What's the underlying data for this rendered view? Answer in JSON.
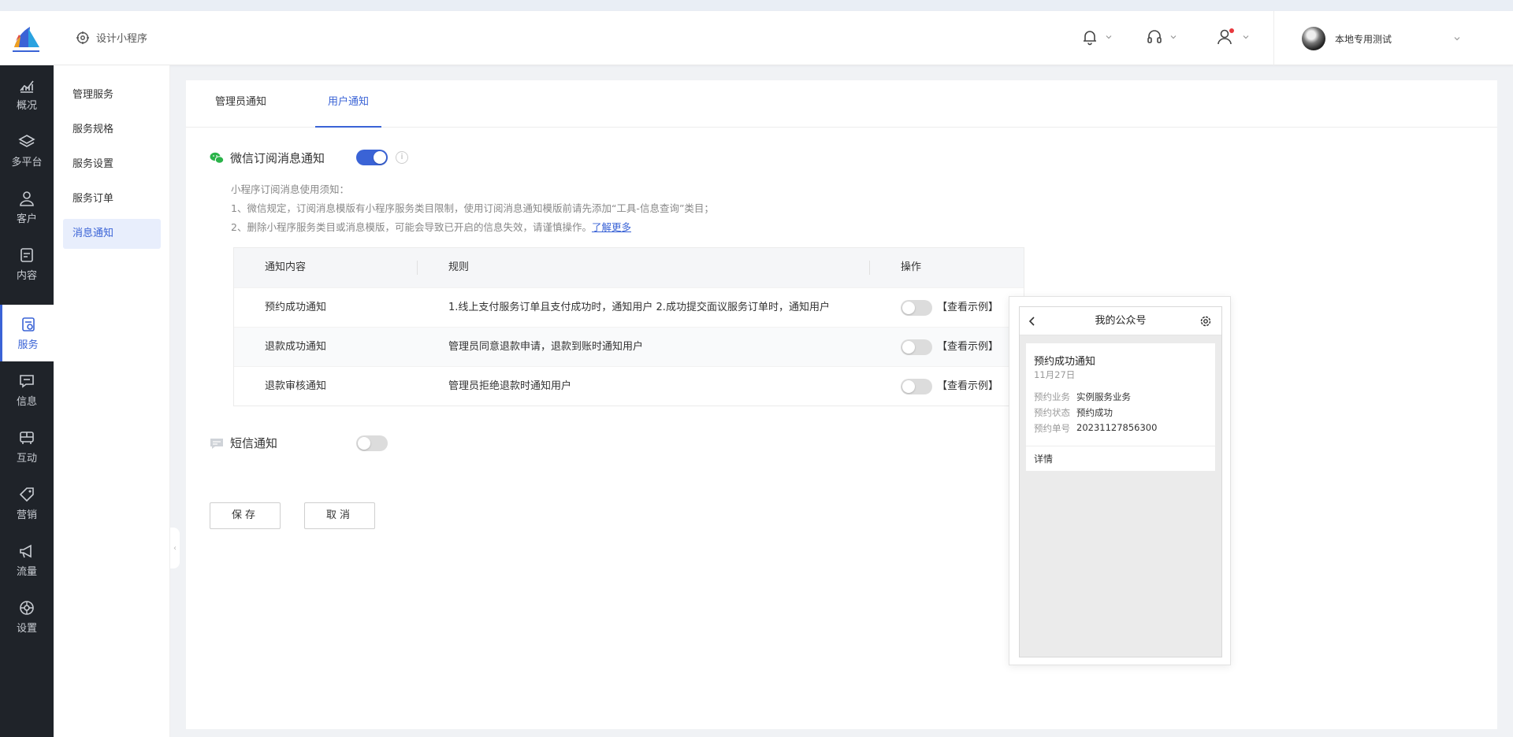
{
  "header": {
    "design_label": "设计小程序",
    "user_name": "本地专用测试"
  },
  "sidebar": {
    "items": [
      {
        "label": "概况",
        "icon": "chart-icon"
      },
      {
        "label": "多平台",
        "icon": "layers-icon"
      },
      {
        "label": "客户",
        "icon": "user-icon"
      },
      {
        "label": "内容",
        "icon": "document-icon"
      },
      {
        "label": "服务",
        "icon": "service-icon"
      },
      {
        "label": "信息",
        "icon": "message-icon"
      },
      {
        "label": "互动",
        "icon": "game-icon"
      },
      {
        "label": "营销",
        "icon": "tag-icon"
      },
      {
        "label": "流量",
        "icon": "megaphone-icon"
      },
      {
        "label": "设置",
        "icon": "settings-icon"
      }
    ]
  },
  "subnav": {
    "items": [
      "管理服务",
      "服务规格",
      "服务设置",
      "服务订单",
      "消息通知"
    ]
  },
  "tabs": [
    "管理员通知",
    "用户通知"
  ],
  "wechat": {
    "title": "微信订阅消息通知",
    "notes": [
      "小程序订阅消息使用须知：",
      "1、微信规定，订阅消息模版有小程序服务类目限制，使用订阅消息通知模版前请先添加“工具-信息查询”类目；",
      "2、删除小程序服务类目或消息模版，可能会导致已开启的信息失效，请谨慎操作。"
    ],
    "learn_more": "了解更多"
  },
  "table": {
    "headers": [
      "通知内容",
      "规则",
      "操作"
    ],
    "rows": [
      {
        "name": "预约成功通知",
        "rule": "1.线上支付服务订单且支付成功时，通知用户  2.成功提交面议服务订单时，通知用户",
        "action": "【查看示例】"
      },
      {
        "name": "退款成功通知",
        "rule": "管理员同意退款申请，退款到账时通知用户",
        "action": "【查看示例】"
      },
      {
        "name": "退款审核通知",
        "rule": "管理员拒绝退款时通知用户",
        "action": "【查看示例】"
      }
    ]
  },
  "sms": {
    "title": "短信通知"
  },
  "buttons": {
    "save": "保存",
    "cancel": "取消"
  },
  "phone": {
    "title": "我的公众号",
    "card_title": "预约成功通知",
    "card_date": "11月27日",
    "fields": [
      {
        "label": "预约业务",
        "value": "实例服务业务"
      },
      {
        "label": "预约状态",
        "value": "预约成功"
      },
      {
        "label": "预约单号",
        "value": "20231127856300"
      }
    ],
    "detail": "详情"
  },
  "colors": {
    "accent": "#3a63d6",
    "sidebar_bg": "#1f2329",
    "wechat_green": "#2bb34a"
  }
}
